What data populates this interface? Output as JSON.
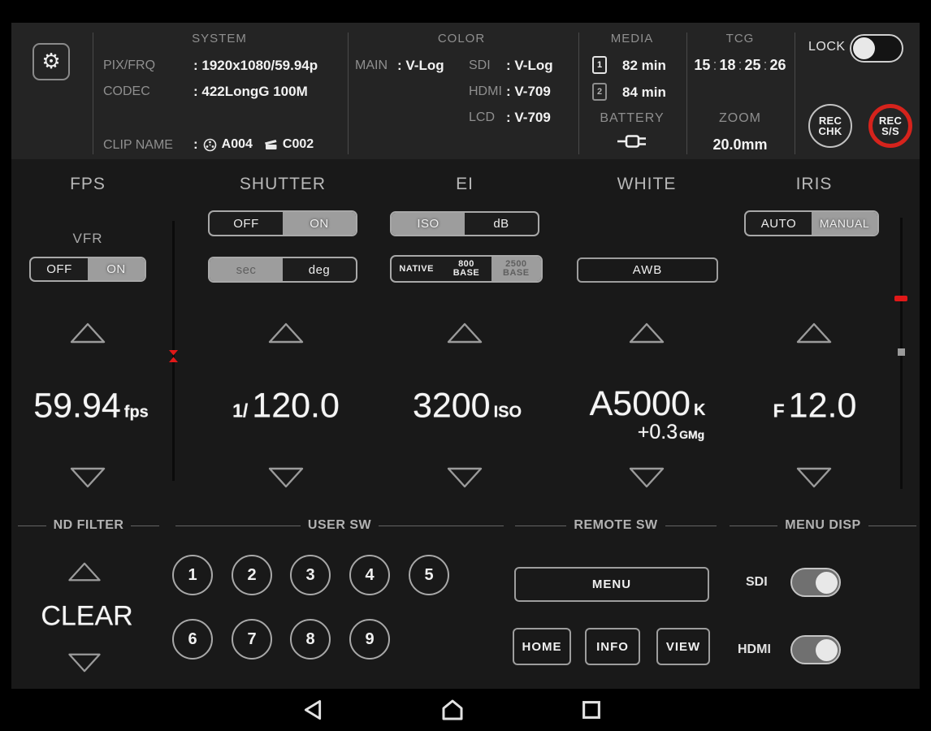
{
  "header": {
    "system": {
      "title": "SYSTEM",
      "pix_frq_label": "PIX/FRQ",
      "pix_frq_value": ": 1920x1080/59.94p",
      "codec_label": "CODEC",
      "codec_value": ": 422LongG 100M",
      "clip_name_label": "CLIP NAME",
      "colon": ":",
      "reel_id": "A004",
      "clip_id": "C002"
    },
    "color": {
      "title": "COLOR",
      "main_label": "MAIN",
      "main_value": ": V-Log",
      "sdi_label": "SDI",
      "sdi_value": ": V-Log",
      "hdmi_label": "HDMI",
      "hdmi_value": ": V-709",
      "lcd_label": "LCD",
      "lcd_value": ": V-709"
    },
    "media": {
      "title": "MEDIA",
      "slot1_num": "1",
      "slot1_time": "82 min",
      "slot2_num": "2",
      "slot2_time": "84 min",
      "battery_label": "BATTERY"
    },
    "tcg": {
      "title": "TCG",
      "hours": "15",
      "minutes": "18",
      "seconds": "25",
      "frames": "26",
      "separator": ":",
      "zoom_label": "ZOOM",
      "zoom_value": "20.0mm"
    },
    "lock_label": "LOCK",
    "rec_chk_line1": "REC",
    "rec_chk_line2": "CHK",
    "rec_ss_line1": "REC",
    "rec_ss_line2": "S/S"
  },
  "fps": {
    "title": "FPS",
    "vfr_label": "VFR",
    "off": "OFF",
    "on": "ON",
    "value": "59.94",
    "unit": "fps"
  },
  "shutter": {
    "title": "SHUTTER",
    "off": "OFF",
    "on": "ON",
    "sec": "sec",
    "deg": "deg",
    "prefix": "1/",
    "value": "120.0"
  },
  "ei": {
    "title": "EI",
    "iso": "ISO",
    "db": "dB",
    "native": "NATIVE",
    "base800_l1": "800",
    "base800_l2": "BASE",
    "base2500_l1": "2500",
    "base2500_l2": "BASE",
    "value": "3200",
    "unit": "ISO"
  },
  "white": {
    "title": "WHITE",
    "awb": "AWB",
    "value": "A5000",
    "unit": "K",
    "offset": "+0.3",
    "offset_unit": "GMg"
  },
  "iris": {
    "title": "IRIS",
    "auto": "AUTO",
    "manual": "MANUAL",
    "prefix": "F",
    "value": "12.0"
  },
  "nd": {
    "title": "ND FILTER",
    "value": "CLEAR"
  },
  "user_sw": {
    "title": "USER SW",
    "buttons": [
      "1",
      "2",
      "3",
      "4",
      "5",
      "6",
      "7",
      "8",
      "9"
    ]
  },
  "remote": {
    "title": "REMOTE SW",
    "menu": "MENU",
    "home": "HOME",
    "info": "INFO",
    "view": "VIEW"
  },
  "menu_disp": {
    "title": "MENU DISP",
    "sdi_label": "SDI",
    "hdmi_label": "HDMI"
  },
  "colors": {
    "accent_red": "#d6231c",
    "marker_red": "#e01818",
    "panel_bg": "#191919",
    "header_bg": "#242424",
    "selected_segment": "#9d9d9d"
  }
}
